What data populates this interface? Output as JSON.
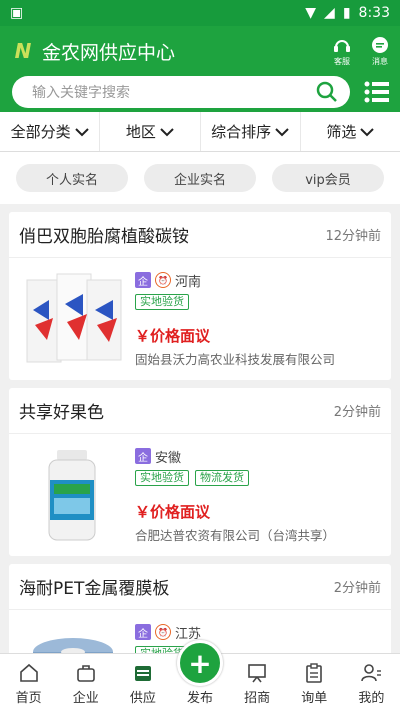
{
  "status": {
    "time": "8:33"
  },
  "header": {
    "title": "金农网供应中心",
    "service_label": "客服",
    "message_label": "消息"
  },
  "search": {
    "placeholder": "输入关键字搜索"
  },
  "filters": [
    {
      "label": "全部分类"
    },
    {
      "label": "地区"
    },
    {
      "label": "综合排序"
    },
    {
      "label": "筛选"
    }
  ],
  "tags": [
    {
      "label": "个人实名"
    },
    {
      "label": "企业实名"
    },
    {
      "label": "vip会员"
    }
  ],
  "cards": [
    {
      "title": "俏巴双胞胎腐植酸碳铵",
      "time": "12分钟前",
      "qi": "企",
      "region": "河南",
      "badges": [
        "实地验货"
      ],
      "price": "￥价格面议",
      "company": "固始县沃力高农业科技发展有限公司"
    },
    {
      "title": "共享好果色",
      "time": "2分钟前",
      "qi": "企",
      "region": "安徽",
      "badges": [
        "实地验货",
        "物流发货"
      ],
      "price": "￥价格面议",
      "company": "合肥达普农资有限公司（台湾共享）"
    },
    {
      "title": "海耐PET金属覆膜板",
      "time": "2分钟前",
      "qi": "企",
      "region": "江苏",
      "badges": [
        "实地验货"
      ],
      "price": "",
      "company": ""
    }
  ],
  "tabbar": [
    {
      "label": "首页"
    },
    {
      "label": "企业"
    },
    {
      "label": "供应"
    },
    {
      "label": "发布"
    },
    {
      "label": "招商"
    },
    {
      "label": "询单"
    },
    {
      "label": "我的"
    }
  ],
  "colors": {
    "brand": "#1ea33f",
    "price": "#e02020",
    "badge_green": "#2aa34a",
    "qi_purple": "#8a6ddf"
  }
}
